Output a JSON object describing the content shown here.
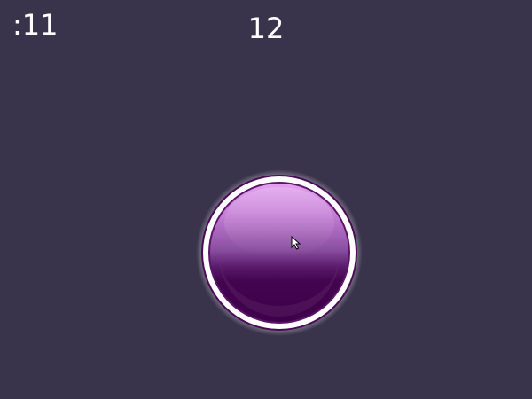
{
  "hud": {
    "timer": ":11",
    "score": "12"
  },
  "colors": {
    "background": "#39334b",
    "orb_top": "#e3a2ef",
    "orb_bottom": "#3f004b",
    "orb_ring": "#ffffff",
    "orb_outline": "#4a0a55"
  },
  "icons": {
    "cursor": "mouse-pointer-icon"
  }
}
